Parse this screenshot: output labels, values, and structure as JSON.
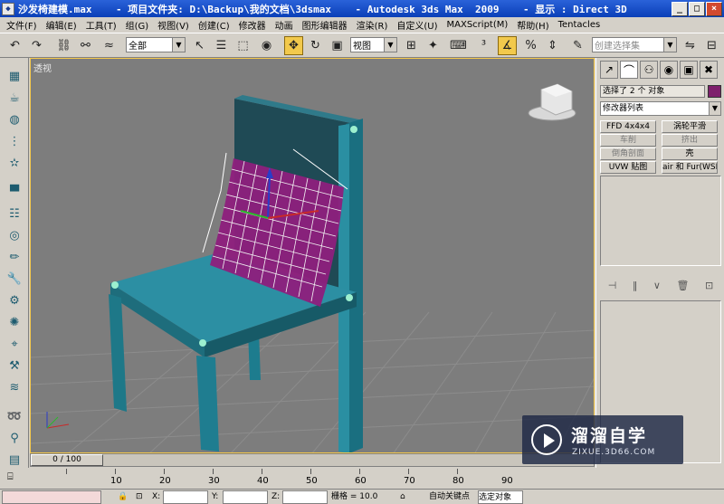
{
  "window": {
    "title": "沙发椅建模.max    - 项目文件夹: D:\\Backup\\我的文档\\3dsmax    - Autodesk 3ds Max  2009    - 显示 : Direct 3D",
    "app_icon": "3ds-max-icon",
    "buttons": {
      "minimize": "_",
      "maximize": "□",
      "close": "×"
    }
  },
  "menu": [
    "文件(F)",
    "编辑(E)",
    "工具(T)",
    "组(G)",
    "视图(V)",
    "创建(C)",
    "修改器",
    "动画",
    "图形编辑器",
    "渲染(R)",
    "自定义(U)",
    "MAXScript(M)",
    "帮助(H)",
    "Tentacles"
  ],
  "toolbar": {
    "selection_filter": "全部",
    "ref_coord": "视图",
    "named_selection_placeholder": "创建选择集"
  },
  "viewport": {
    "label": "透视"
  },
  "command_panel": {
    "selection_info": "选择了 2 个 对象",
    "selection_color": "#7e1f6c",
    "modifier_list": "修改器列表",
    "modifier_buttons": [
      {
        "label": "FFD 4x4x4",
        "enabled": true
      },
      {
        "label": "涡轮平滑",
        "enabled": true
      },
      {
        "label": "车削",
        "enabled": false
      },
      {
        "label": "挤出",
        "enabled": false
      },
      {
        "label": "倒角剖面",
        "enabled": false
      },
      {
        "label": "壳",
        "enabled": true
      },
      {
        "label": "UVW 贴图",
        "enabled": true
      },
      {
        "label": "air 和 Fur(WSM",
        "enabled": true
      }
    ]
  },
  "timeline": {
    "frame_display": "0 / 100",
    "ticks": [
      "10",
      "20",
      "30",
      "40",
      "50",
      "60",
      "70",
      "80",
      "90"
    ]
  },
  "status": {
    "x_label": "X:",
    "y_label": "Y:",
    "z_label": "Z:",
    "grid": "栅格 = 10.0",
    "auto_key": "自动关键点",
    "selected_object": "选定对象"
  },
  "watermark": {
    "name": "溜溜自学",
    "url": "ZIXUE.3D66.COM"
  }
}
